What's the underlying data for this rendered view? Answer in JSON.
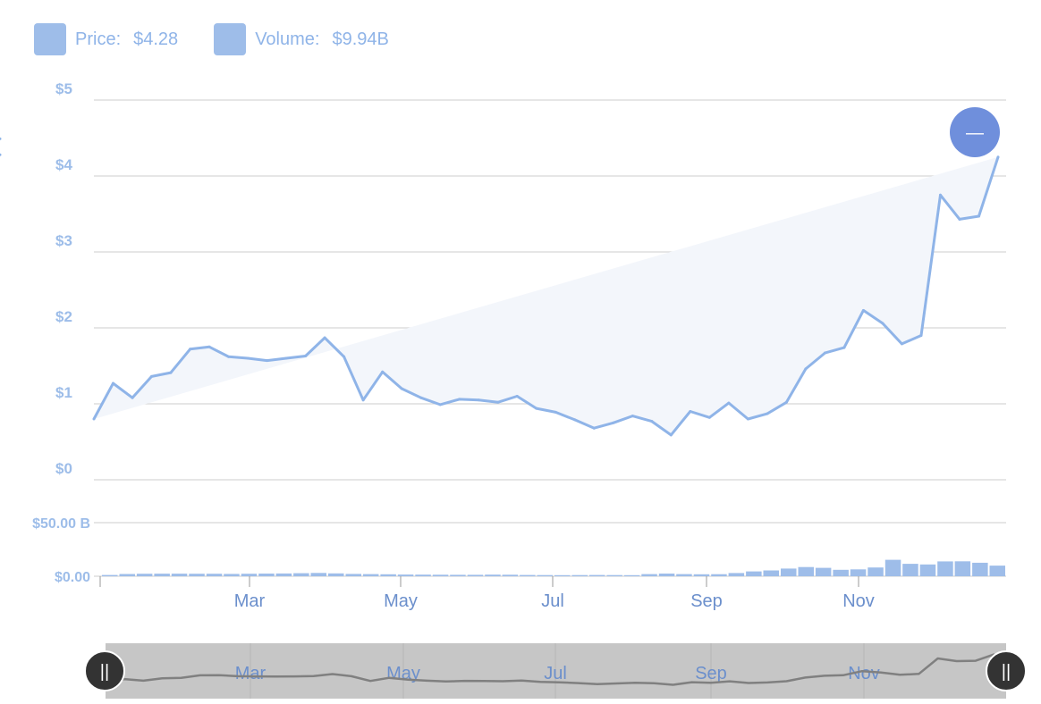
{
  "legend": {
    "price_label": "Price:",
    "price_value": "$4.28",
    "volume_label": "Volume:",
    "volume_value": "$9.94B",
    "price_color": "#8fb4e8",
    "volume_color": "#9ebde9"
  },
  "colors": {
    "line": "#8fb4e8",
    "area": "#f3f6fb",
    "bar": "#9ebde9",
    "grid": "#d8d8d8",
    "marker": "#6f8fdc",
    "navigator_bg": "#c6c6c6",
    "navigator_line": "#808080",
    "handle": "#333333"
  },
  "chart_data": [
    {
      "type": "area",
      "name": "price",
      "x": [
        "2018-01-26",
        "2018-02-02",
        "2018-02-09",
        "2018-02-16",
        "2018-02-23",
        "2018-03-02",
        "2018-03-09",
        "2018-03-16",
        "2018-03-23",
        "2018-03-30",
        "2018-04-06",
        "2018-04-13",
        "2018-04-20",
        "2018-04-27",
        "2018-05-04",
        "2018-05-11",
        "2018-05-18",
        "2018-05-25",
        "2018-06-01",
        "2018-06-08",
        "2018-06-15",
        "2018-06-22",
        "2018-06-29",
        "2018-07-06",
        "2018-07-13",
        "2018-07-20",
        "2018-07-27",
        "2018-08-03",
        "2018-08-10",
        "2018-08-17",
        "2018-08-24",
        "2018-08-31",
        "2018-09-07",
        "2018-09-14",
        "2018-09-21",
        "2018-09-28",
        "2018-10-05",
        "2018-10-12",
        "2018-10-19",
        "2018-10-26",
        "2018-11-02",
        "2018-11-09",
        "2018-11-16",
        "2018-11-23",
        "2018-11-30",
        "2018-12-07",
        "2018-12-14",
        "2018-12-21"
      ],
      "y": [
        0.8,
        1.27,
        1.08,
        1.36,
        1.41,
        1.72,
        1.75,
        1.62,
        1.6,
        1.57,
        1.6,
        1.63,
        1.87,
        1.62,
        1.05,
        1.42,
        1.2,
        1.08,
        0.99,
        1.06,
        1.05,
        1.02,
        1.1,
        0.94,
        0.89,
        0.79,
        0.68,
        0.75,
        0.84,
        0.77,
        0.59,
        0.9,
        0.82,
        1.01,
        0.8,
        0.87,
        1.02,
        1.46,
        1.67,
        1.74,
        2.23,
        2.06,
        1.79,
        1.9,
        3.75,
        3.43,
        3.47,
        4.25,
        4.49,
        4.28
      ],
      "ylim": [
        0,
        5
      ],
      "yticks": [
        "$0",
        "$1",
        "$2",
        "$3",
        "$4",
        "$5"
      ]
    },
    {
      "type": "bar",
      "name": "volume",
      "values_billions": [
        1.2,
        2.1,
        2.3,
        2.4,
        2.4,
        2.3,
        2.3,
        2.2,
        2.3,
        2.5,
        2.6,
        2.8,
        3.1,
        2.7,
        2.2,
        2.0,
        1.8,
        1.6,
        1.5,
        1.4,
        1.3,
        1.3,
        1.5,
        1.4,
        1.2,
        1.1,
        1.0,
        1.1,
        1.2,
        1.1,
        1.0,
        2.0,
        2.5,
        2.0,
        1.8,
        1.9,
        3.0,
        4.5,
        5.4,
        7.2,
        8.6,
        7.8,
        6.0,
        6.4,
        8.2,
        15.3,
        11.6,
        11.0,
        13.8,
        13.9,
        12.6,
        9.94
      ],
      "ylim": [
        0,
        50
      ],
      "yticks": [
        "$0.00",
        "$50.00 B"
      ]
    }
  ],
  "x_axis": {
    "ticks": [
      "Mar",
      "May",
      "Jul",
      "Sep",
      "Nov"
    ]
  },
  "navigator": {
    "ticks": [
      "Mar",
      "May",
      "Jul",
      "Sep",
      "Nov"
    ],
    "left_handle": "||",
    "right_handle": "||"
  },
  "marker": {
    "symbol": "—"
  }
}
